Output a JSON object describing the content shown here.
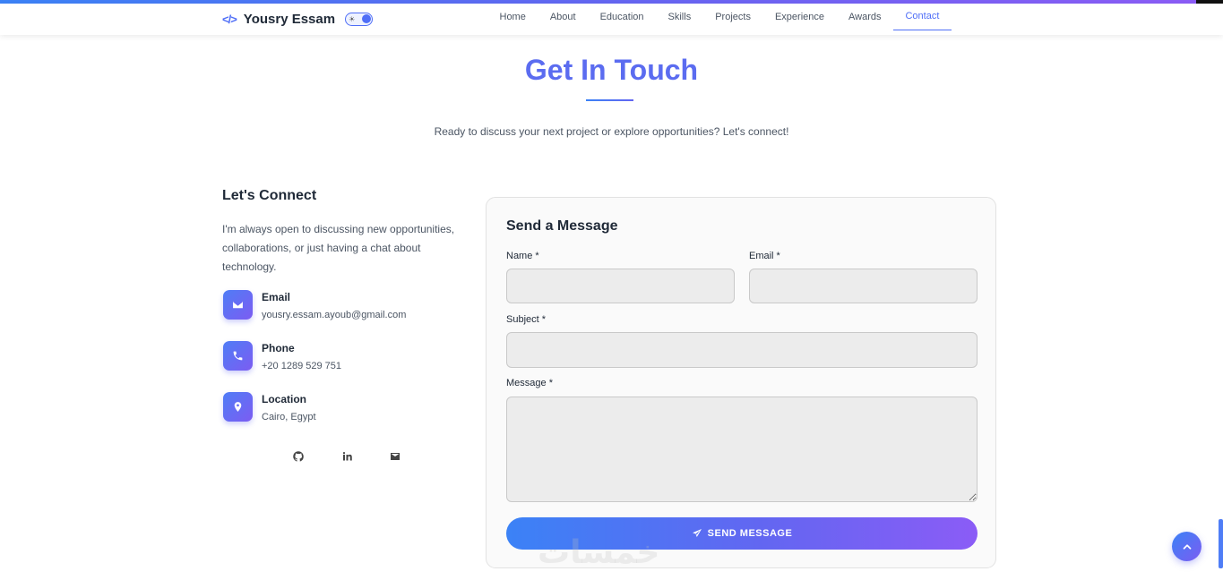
{
  "header": {
    "brand_name": "Yousry Essam",
    "nav": [
      {
        "label": "Home"
      },
      {
        "label": "About"
      },
      {
        "label": "Education"
      },
      {
        "label": "Skills"
      },
      {
        "label": "Projects"
      },
      {
        "label": "Experience"
      },
      {
        "label": "Awards"
      },
      {
        "label": "Contact",
        "active": true
      }
    ]
  },
  "hero": {
    "title": "Get In Touch",
    "subtitle": "Ready to discuss your next project or explore opportunities? Let's connect!"
  },
  "connect": {
    "title": "Let's Connect",
    "description": "I'm always open to discussing new opportunities, collaborations, or just having a chat about technology.",
    "items": [
      {
        "icon": "envelope-icon",
        "label": "Email",
        "value": "yousry.essam.ayoub@gmail.com"
      },
      {
        "icon": "phone-icon",
        "label": "Phone",
        "value": "+20 1289 529 751"
      },
      {
        "icon": "location-pin-icon",
        "label": "Location",
        "value": "Cairo, Egypt"
      }
    ],
    "socials": [
      "github-icon",
      "linkedin-icon",
      "envelope-icon"
    ]
  },
  "form": {
    "title": "Send a Message",
    "name_label": "Name *",
    "email_label": "Email *",
    "subject_label": "Subject *",
    "message_label": "Message *",
    "name_value": "",
    "email_value": "",
    "subject_value": "",
    "message_value": "",
    "submit_label": "SEND MESSAGE"
  },
  "watermark": "خمسات",
  "colors": {
    "accent": "#5b6cf0",
    "gradient_start": "#3b82f6",
    "gradient_end": "#8b5cf6"
  }
}
